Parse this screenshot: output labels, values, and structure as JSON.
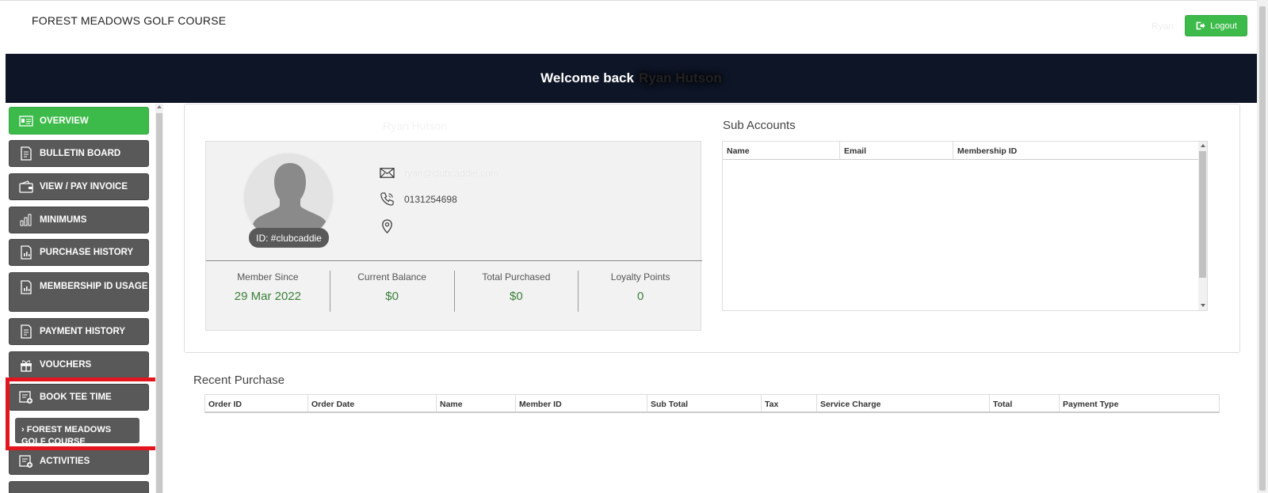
{
  "header": {
    "brand": "FOREST MEADOWS GOLF COURSE",
    "user_name": "Ryan",
    "logout_label": "Logout",
    "welcome_prefix": "Welcome back",
    "welcome_name": "Ryan Hutson"
  },
  "sidebar": {
    "items": [
      {
        "label": "OVERVIEW",
        "icon": "id-card-icon",
        "active": true
      },
      {
        "label": "BULLETIN BOARD",
        "icon": "document-icon"
      },
      {
        "label": "VIEW / PAY INVOICE",
        "icon": "wallet-icon"
      },
      {
        "label": "MINIMUMS",
        "icon": "chart-icon"
      },
      {
        "label": "PURCHASE HISTORY",
        "icon": "report-icon"
      },
      {
        "label": "MEMBERSHIP ID USAGE",
        "icon": "report-icon"
      },
      {
        "label": "PAYMENT HISTORY",
        "icon": "document-icon"
      },
      {
        "label": "VOUCHERS",
        "icon": "gift-icon"
      },
      {
        "label": "BOOK TEE TIME",
        "icon": "calendar-add-icon"
      },
      {
        "label": "ACTIVITIES",
        "icon": "calendar-add-icon"
      }
    ],
    "sub_item": "› FOREST MEADOWS GOLF COURSE"
  },
  "profile": {
    "name": "Ryan Hutson",
    "id_badge": "ID: #clubcaddie",
    "email": "ryan@clubcaddie.com",
    "phone": "0131254698",
    "address": "",
    "stats": [
      {
        "label": "Member Since",
        "value": "29 Mar 2022"
      },
      {
        "label": "Current Balance",
        "value": "$0"
      },
      {
        "label": "Total Purchased",
        "value": "$0"
      },
      {
        "label": "Loyalty Points",
        "value": "0"
      }
    ]
  },
  "sub_accounts": {
    "title": "Sub Accounts",
    "columns": [
      "Name",
      "Email",
      "Membership ID"
    ]
  },
  "recent_purchase": {
    "title": "Recent Purchase",
    "columns": [
      "Order ID",
      "Order Date",
      "Name",
      "Member ID",
      "Sub Total",
      "Tax",
      "Service Charge",
      "Total",
      "Payment Type"
    ]
  },
  "colors": {
    "accent_green": "#3dbb4a",
    "banner_navy": "#0e1526",
    "sidebar_gray": "#595959",
    "highlight_red": "#e3161f",
    "stat_green": "#3a7f3a"
  }
}
